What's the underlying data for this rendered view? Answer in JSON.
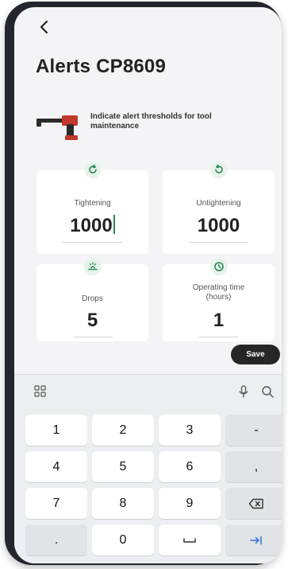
{
  "header": {
    "title": "Alerts CP8609"
  },
  "intro": {
    "text": "Indicate alert thresholds for tool maintenance"
  },
  "cards": [
    {
      "id": "tightening",
      "label": "Tightening",
      "value": "1000",
      "icon": "rotate-cw-icon"
    },
    {
      "id": "untightening",
      "label": "Untightening",
      "value": "1000",
      "icon": "rotate-ccw-icon"
    },
    {
      "id": "drops",
      "label": "Drops",
      "value": "5",
      "icon": "drop-impact-icon"
    },
    {
      "id": "operating-time",
      "label": "Operating time (hours)",
      "value": "1",
      "icon": "clock-icon"
    }
  ],
  "actions": {
    "save_label": "Save"
  },
  "keyboard": {
    "rows": [
      [
        "1",
        "2",
        "3",
        "-"
      ],
      [
        "4",
        "5",
        "6",
        ","
      ],
      [
        "7",
        "8",
        "9",
        "backspace"
      ],
      [
        ".",
        "0",
        "space",
        "tab"
      ]
    ]
  },
  "colors": {
    "accent_green": "#2c8a53",
    "icon_bg": "#e8f3ec",
    "save_bg": "#262626",
    "frame": "#24262d"
  }
}
